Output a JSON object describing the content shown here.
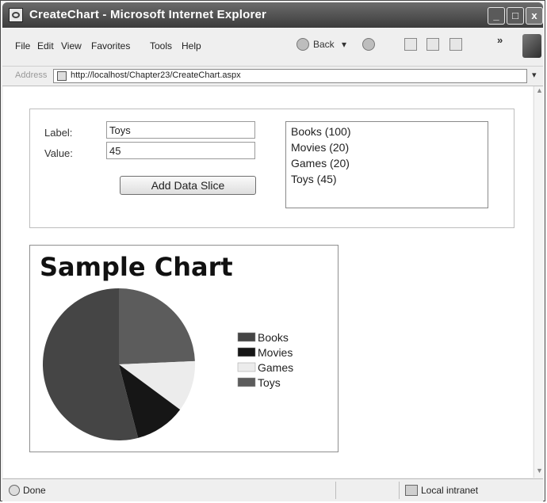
{
  "window": {
    "title": "CreateChart - Microsoft Internet Explorer",
    "minimize": "_",
    "maximize": "□",
    "close": "x"
  },
  "menu": {
    "file": "File",
    "edit": "Edit",
    "view": "View",
    "favorites": "Favorites",
    "tools": "Tools",
    "help": "Help"
  },
  "toolbar": {
    "back": "Back",
    "more": "»",
    "icons": [
      "back-arrow-icon",
      "forward-arrow-icon",
      "stop-icon",
      "refresh-icon",
      "home-icon"
    ]
  },
  "address": {
    "label": "Address",
    "url": "http://localhost/Chapter23/CreateChart.aspx"
  },
  "form": {
    "label_caption": "Label:",
    "label_value": "Toys",
    "value_caption": "Value:",
    "value_value": "45",
    "add_button": "Add Data Slice",
    "slices": [
      "Books (100)",
      "Movies (20)",
      "Games (20)",
      "Toys (45)"
    ]
  },
  "chart_data": {
    "type": "pie",
    "title": "Sample Chart",
    "categories": [
      "Books",
      "Movies",
      "Games",
      "Toys"
    ],
    "values": [
      100,
      20,
      20,
      45
    ],
    "colors": [
      "#454545",
      "#161616",
      "#ececec",
      "#5c5c5c"
    ],
    "legend_position": "right"
  },
  "status": {
    "text": "Done",
    "zone": "Local intranet"
  }
}
